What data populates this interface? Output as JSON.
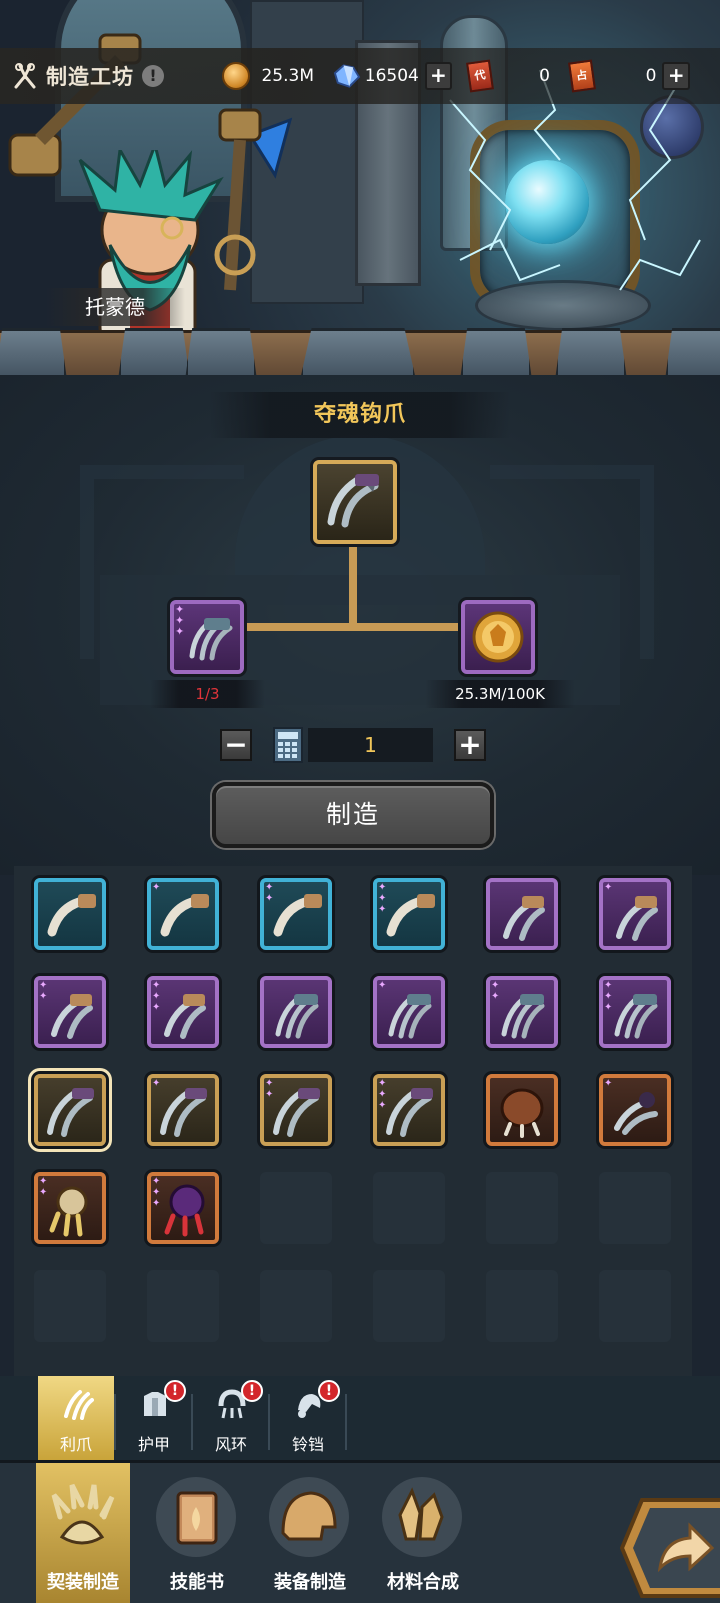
{
  "header": {
    "title": "制造工坊",
    "info_symbol": "!",
    "character_name": "托蒙德"
  },
  "resources": {
    "gold": "25.3M",
    "crystals": "16504",
    "ticket_red": "0",
    "ticket_orange": "0",
    "ticket_red_glyph": "代",
    "ticket_orange_glyph": "占",
    "plus_symbol": "+"
  },
  "recipe": {
    "item_name": "夺魂钩爪",
    "material_count": "1/3",
    "gold_cost": "25.3M/100K",
    "quantity": "1",
    "minus_symbol": "−",
    "plus_symbol": "+",
    "craft_label": "制造"
  },
  "items": [
    {
      "quality": "blue",
      "stars": "",
      "icon": "fang-claw-icon"
    },
    {
      "quality": "blue",
      "stars": "✦",
      "icon": "fang-claw-icon"
    },
    {
      "quality": "blue",
      "stars": "✦✦",
      "icon": "fang-claw-icon"
    },
    {
      "quality": "blue",
      "stars": "✦✦✦",
      "icon": "fang-claw-icon"
    },
    {
      "quality": "purple",
      "stars": "",
      "icon": "talon-claw-icon"
    },
    {
      "quality": "purple",
      "stars": "✦",
      "icon": "talon-claw-icon"
    },
    {
      "quality": "purple",
      "stars": "✦✦",
      "icon": "talon-claw-icon"
    },
    {
      "quality": "purple",
      "stars": "✦✦✦",
      "icon": "talon-claw-icon"
    },
    {
      "quality": "purple",
      "stars": "",
      "icon": "triple-claw-icon"
    },
    {
      "quality": "purple",
      "stars": "✦",
      "icon": "triple-claw-icon"
    },
    {
      "quality": "purple",
      "stars": "✦✦",
      "icon": "triple-claw-icon"
    },
    {
      "quality": "purple",
      "stars": "✦✦✦",
      "icon": "triple-claw-icon"
    },
    {
      "quality": "gold",
      "stars": "",
      "icon": "soul-hook-claw-icon",
      "selected": true
    },
    {
      "quality": "gold",
      "stars": "✦",
      "icon": "soul-hook-claw-icon"
    },
    {
      "quality": "gold",
      "stars": "✦✦",
      "icon": "soul-hook-claw-icon"
    },
    {
      "quality": "gold",
      "stars": "✦✦✦",
      "icon": "soul-hook-claw-icon"
    },
    {
      "quality": "orange",
      "stars": "",
      "icon": "beetle-claw-icon"
    },
    {
      "quality": "orange",
      "stars": "✦",
      "icon": "spike-claw-icon"
    },
    {
      "quality": "orange",
      "stars": "✦✦",
      "icon": "bone-claw-icon"
    },
    {
      "quality": "orange",
      "stars": "✦✦✦",
      "icon": "venom-claw-icon"
    }
  ],
  "categories": [
    {
      "label": "利爪",
      "icon": "claw-icon",
      "active": true,
      "badge": ""
    },
    {
      "label": "护甲",
      "icon": "armor-icon",
      "active": false,
      "badge": "!"
    },
    {
      "label": "风环",
      "icon": "wind-ring-icon",
      "active": false,
      "badge": "!"
    },
    {
      "label": "铃铛",
      "icon": "bell-icon",
      "active": false,
      "badge": "!"
    }
  ],
  "nav": [
    {
      "label": "契装制造",
      "icon": "paw-icon",
      "active": true
    },
    {
      "label": "技能书",
      "icon": "book-icon",
      "active": false
    },
    {
      "label": "装备制造",
      "icon": "helmet-icon",
      "active": false
    },
    {
      "label": "材料合成",
      "icon": "crystal-icon",
      "active": false
    }
  ],
  "colors": {
    "accent_gold": "#f1c65a",
    "counter_red": "#e0343a",
    "quality_blue": "#41b2d6",
    "quality_purple": "#a472c6",
    "quality_gold": "#c99f55",
    "quality_orange": "#d17a3c"
  }
}
